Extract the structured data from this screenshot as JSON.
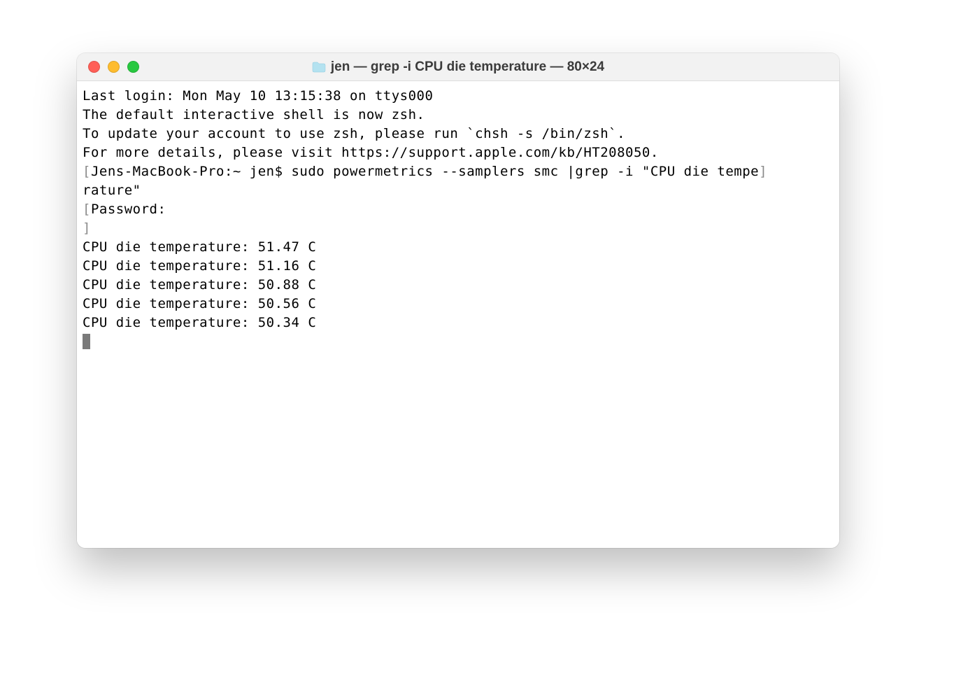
{
  "window": {
    "title": "jen — grep -i CPU die temperature — 80×24"
  },
  "terminal": {
    "last_login": "Last login: Mon May 10 13:15:38 on ttys000",
    "blank": "",
    "zsh_notice_1": "The default interactive shell is now zsh.",
    "zsh_notice_2": "To update your account to use zsh, please run `chsh -s /bin/zsh`.",
    "zsh_notice_3": "For more details, please visit https://support.apple.com/kb/HT208050.",
    "prompt_open": "[",
    "prompt_text": "Jens-MacBook-Pro:~ jen$ sudo powermetrics --samplers smc |grep -i \"CPU die tempe",
    "prompt_close": "]",
    "prompt_cont": "rature\"",
    "password_open": "[",
    "password_text": "Password:",
    "password_close": "]",
    "out1": "CPU die temperature: 51.47 C",
    "out2": "CPU die temperature: 51.16 C",
    "out3": "CPU die temperature: 50.88 C",
    "out4": "CPU die temperature: 50.56 C",
    "out5": "CPU die temperature: 50.34 C"
  }
}
